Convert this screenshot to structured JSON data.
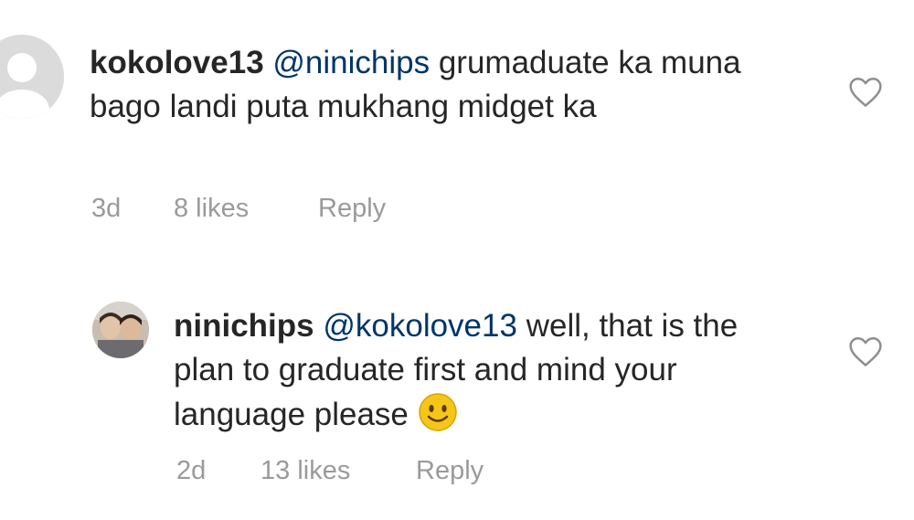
{
  "comments": [
    {
      "username": "kokolove13",
      "mention": "@ninichips",
      "text": "grumaduate ka muna bago landi puta mukhang midget ka",
      "age": "3d",
      "likes": "8 likes",
      "reply_label": "Reply",
      "avatar_icon": "default-avatar-icon",
      "like_icon": "heart-outline-icon"
    },
    {
      "username": "ninichips",
      "mention": "@kokolove13",
      "text": "well, that is the plan to graduate first and mind your language please",
      "emoji_icon": "slightly-smiling-face-emoji",
      "age": "2d",
      "likes": "13 likes",
      "reply_label": "Reply",
      "avatar_icon": "profile-photo-avatar",
      "like_icon": "heart-outline-icon"
    }
  ],
  "colors": {
    "text": "#262626",
    "meta": "#9a9a9a",
    "icon_stroke": "#8e8e8e",
    "default_avatar": "#dbdbdb"
  }
}
